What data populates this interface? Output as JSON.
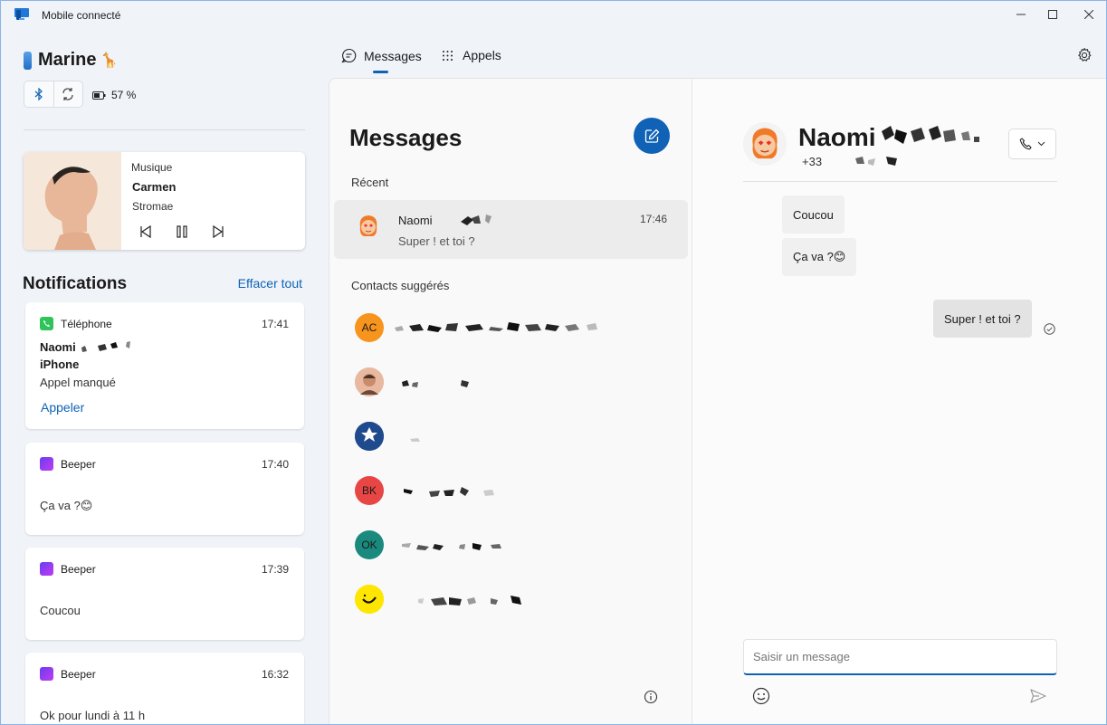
{
  "window": {
    "title": "Mobile connecté"
  },
  "device": {
    "name": "Marine",
    "emoji": "🦒",
    "battery": "57 %"
  },
  "music": {
    "label": "Musique",
    "title": "Carmen",
    "artist": "Stromae"
  },
  "notifications": {
    "title": "Notifications",
    "clear_all": "Effacer tout",
    "items": [
      {
        "app": "Téléphone",
        "time": "17:41",
        "sender": "Naomi",
        "sender2": "iPhone",
        "body": "Appel manqué",
        "action": "Appeler"
      },
      {
        "app": "Beeper",
        "time": "17:40",
        "body": "Ça va ?😊"
      },
      {
        "app": "Beeper",
        "time": "17:39",
        "body": "Coucou"
      },
      {
        "app": "Beeper",
        "time": "16:32",
        "body": "Ok pour lundi à 11 h"
      }
    ]
  },
  "tabs": [
    {
      "label": "Messages"
    },
    {
      "label": "Appels"
    }
  ],
  "messages": {
    "heading": "Messages",
    "recent_label": "Récent",
    "recent": {
      "name": "Naomi",
      "preview": "Super ! et toi ?",
      "time": "17:46"
    },
    "suggested_label": "Contacts suggérés",
    "suggested": [
      {
        "initials": "AC",
        "color": "#f7941d"
      },
      {
        "initials": "",
        "color": "#e8b9a0"
      },
      {
        "initials": "",
        "color": "#1f4b8e"
      },
      {
        "initials": "BK",
        "color": "#e84545"
      },
      {
        "initials": "OK",
        "color": "#1a8a7e"
      },
      {
        "initials": "",
        "color": "#ffe600"
      }
    ]
  },
  "chat": {
    "name": "Naomi",
    "number": "+33",
    "messages": [
      {
        "text": "Coucou",
        "dir": "in"
      },
      {
        "text": "Ça va ?😊",
        "dir": "in"
      },
      {
        "text": "Super ! et toi ?",
        "dir": "out"
      }
    ],
    "input_placeholder": "Saisir un message"
  },
  "colors": {
    "accent": "#0f62b5"
  }
}
